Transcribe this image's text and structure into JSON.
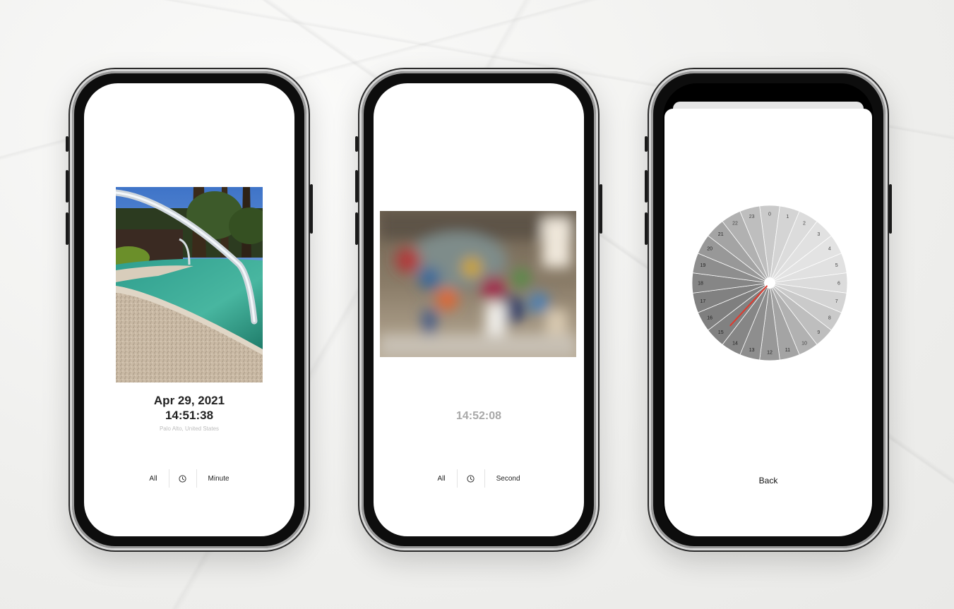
{
  "phones": [
    {
      "date": "Apr 29, 2021",
      "time": "14:51:38",
      "location": "Palo Alto, United States",
      "nav": {
        "left": "All",
        "icon": "clock-icon",
        "right": "Minute"
      }
    },
    {
      "time": "14:52:08",
      "nav": {
        "left": "All",
        "icon": "clock-icon",
        "right": "Second"
      }
    },
    {
      "dial_hours": [
        "0",
        "1",
        "2",
        "3",
        "4",
        "5",
        "6",
        "7",
        "8",
        "9",
        "10",
        "11",
        "12",
        "13",
        "14",
        "15",
        "16",
        "17",
        "18",
        "19",
        "20",
        "21",
        "22",
        "23"
      ],
      "back": "Back",
      "colors": {
        "hand": "#e03a2e"
      }
    }
  ]
}
